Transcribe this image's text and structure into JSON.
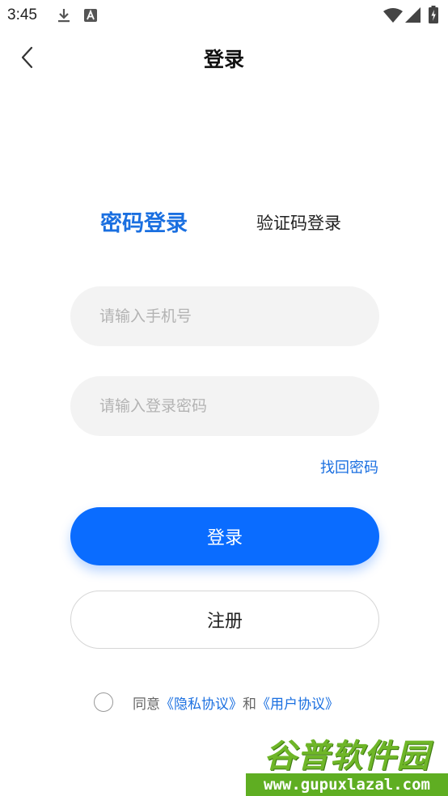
{
  "status_bar": {
    "time": "3:45",
    "left_icons": [
      "download-icon",
      "a-badge-icon"
    ],
    "right_icons": [
      "wifi-icon",
      "signal-icon",
      "battery-charging-icon"
    ]
  },
  "nav": {
    "back_icon": "chevron-left-icon",
    "title": "登录"
  },
  "tabs": [
    {
      "label": "密码登录",
      "active": true
    },
    {
      "label": "验证码登录",
      "active": false
    }
  ],
  "form": {
    "phone_placeholder": "请输入手机号",
    "phone_value": "",
    "password_placeholder": "请输入登录密码",
    "password_value": "",
    "forgot_label": "找回密码",
    "login_label": "登录",
    "register_label": "注册"
  },
  "agreement": {
    "checked": false,
    "prefix": "同意",
    "privacy_label": "《隐私协议》",
    "and": "和",
    "user_label": "《用户协议》"
  },
  "watermark": {
    "main": "谷普软件园",
    "sub": "www.gupuxlazal.com"
  },
  "colors": {
    "accent": "#1a6fe0",
    "button_primary": "#0a6cff",
    "input_bg": "#f3f3f3",
    "watermark_green": "#5fae22"
  }
}
